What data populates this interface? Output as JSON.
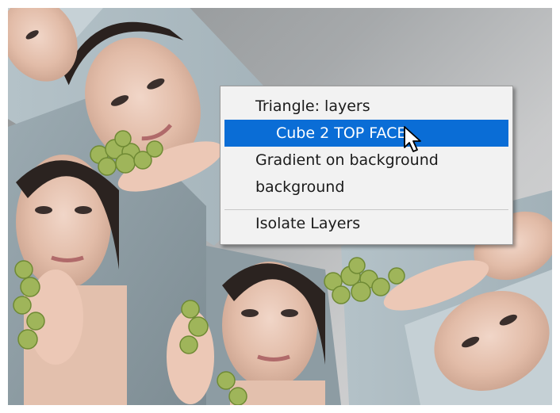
{
  "context_menu": {
    "items": [
      {
        "label": "Triangle: layers"
      },
      {
        "label": "Cube 2 TOP FACE",
        "selected": true
      },
      {
        "label": "Gradient on background"
      },
      {
        "label": "background"
      }
    ],
    "isolate_label": "Isolate Layers"
  },
  "colors": {
    "highlight": "#0a6dd6",
    "menu_bg": "#f2f2f2",
    "canvas_bg": "#a8a9ab"
  },
  "icons": {
    "cursor": "arrow-pointer-icon"
  }
}
